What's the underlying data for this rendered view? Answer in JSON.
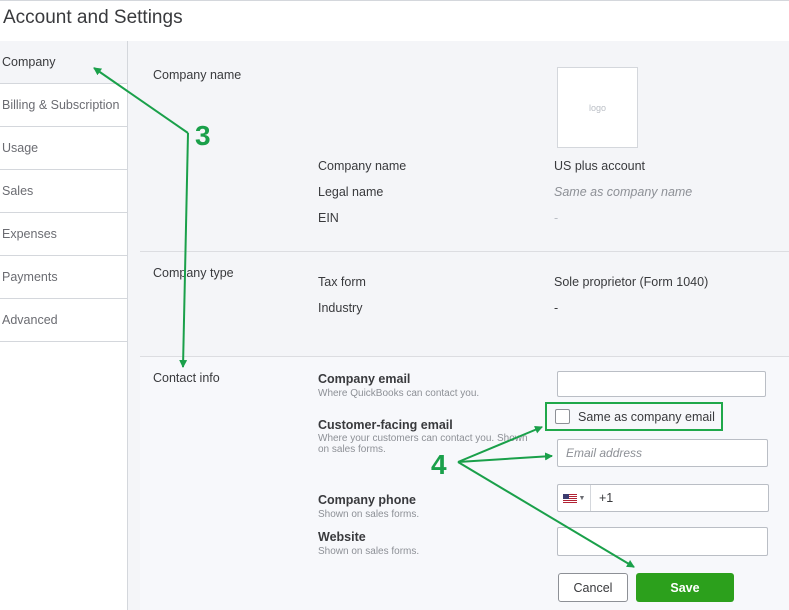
{
  "page": {
    "title": "Account and Settings"
  },
  "sidebar": {
    "items": [
      {
        "label": "Company",
        "active": true
      },
      {
        "label": "Billing & Subscription"
      },
      {
        "label": "Usage"
      },
      {
        "label": "Sales"
      },
      {
        "label": "Expenses"
      },
      {
        "label": "Payments"
      },
      {
        "label": "Advanced"
      }
    ]
  },
  "company_name_section": {
    "title": "Company name",
    "logo_text": "logo",
    "fields": [
      {
        "label": "Company name",
        "value": "US plus account"
      },
      {
        "label": "Legal name",
        "value": "Same as company name"
      },
      {
        "label": "EIN",
        "value": "-"
      }
    ]
  },
  "company_type_section": {
    "title": "Company type",
    "fields": [
      {
        "label": "Tax form",
        "value": "Sole proprietor (Form 1040)"
      },
      {
        "label": "Industry",
        "value": "-"
      }
    ]
  },
  "contact_section": {
    "title": "Contact info",
    "company_email": {
      "label": "Company email",
      "help": "Where QuickBooks can contact you.",
      "value": ""
    },
    "customer_email": {
      "label": "Customer-facing email",
      "help": "Where your customers can contact you. Shown on sales forms.",
      "checkbox_label": "Same as company email",
      "placeholder": "Email address",
      "checked": false
    },
    "company_phone": {
      "label": "Company phone",
      "help": "Shown on sales forms.",
      "country_code": "+1",
      "flag_icon": "us-flag-icon"
    },
    "website": {
      "label": "Website",
      "help": "Shown on sales forms.",
      "value": ""
    }
  },
  "actions": {
    "cancel_label": "Cancel",
    "save_label": "Save"
  },
  "annotations": {
    "callout_3": "3",
    "callout_4": "4",
    "color": "#1aa04a"
  },
  "colors": {
    "save_button": "#2ca01c",
    "annotation_green": "#1aa04a",
    "panel_bg": "#f4f5f8"
  }
}
